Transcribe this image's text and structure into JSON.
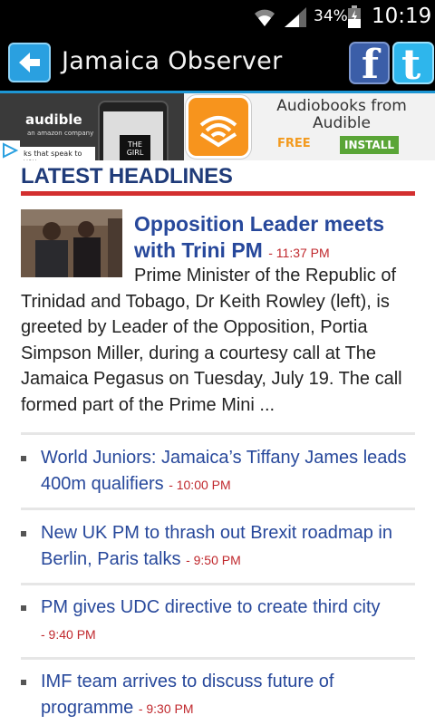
{
  "status_bar": {
    "battery": "34%",
    "time": "10:19"
  },
  "app": {
    "title": "Jamaica Observer"
  },
  "ad": {
    "brand": "audible",
    "brand_sub": "an amazon company",
    "tagline": "ks that speak to you",
    "book_title": "THE GIRL",
    "title": "Audiobooks from Audible",
    "price": "FREE",
    "cta": "INSTALL"
  },
  "section": {
    "title": "LATEST HEADLINES"
  },
  "lead": {
    "headline": "Opposition Leader meets with Trini PM",
    "time": "- 11:37 PM",
    "summary": "Prime Minister of the Republic of Trinidad and Tobago, Dr Keith Rowley (left), is greeted by Leader of the Opposition, Portia Simpson Miller, during a courtesy call at The Jamaica Pegasus on Tuesday, July 19. The call formed part of the Prime Mini ..."
  },
  "headlines": [
    {
      "title": "World Juniors: Jamaica’s Tiffany James leads 400m qualifiers",
      "time": "- 10:00 PM"
    },
    {
      "title": "New UK PM to thrash out Brexit roadmap in Berlin, Paris talks",
      "time": "- 9:50 PM"
    },
    {
      "title": "PM gives UDC directive to create third city",
      "time": "- 9:40 PM"
    },
    {
      "title": "IMF team arrives to discuss future of programme",
      "time": "- 9:30 PM"
    }
  ]
}
